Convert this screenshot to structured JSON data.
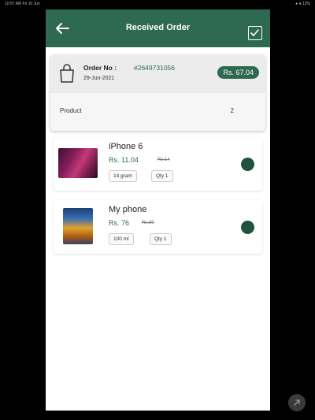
{
  "status_bar": {
    "left": "10:57 AM  Fri 10 Jun",
    "right": "● ●  12%"
  },
  "app_bar": {
    "title": "Received Order"
  },
  "order": {
    "label": "Order No :",
    "number": "#2649731056",
    "date": "29-Jun-2021",
    "total": "Rs. 67.04",
    "product_label": "Product",
    "product_count": "2"
  },
  "items": [
    {
      "name": "iPhone 6",
      "price": "Rs. 11.04",
      "old_price": "Rs.14",
      "weight": "14 gram",
      "qty": "Qty 1"
    },
    {
      "name": "My phone",
      "price": "Rs. 76",
      "old_price": "Rs.80",
      "weight": "100 ml",
      "qty": "Qty 1"
    }
  ],
  "colors": {
    "primary": "#2e6a52",
    "status_dot": "#21523e"
  },
  "icons": {
    "back": "arrow-left-icon",
    "confirm": "checkbox-check-icon",
    "order": "shopping-bag-icon",
    "fab": "expand-icon"
  }
}
